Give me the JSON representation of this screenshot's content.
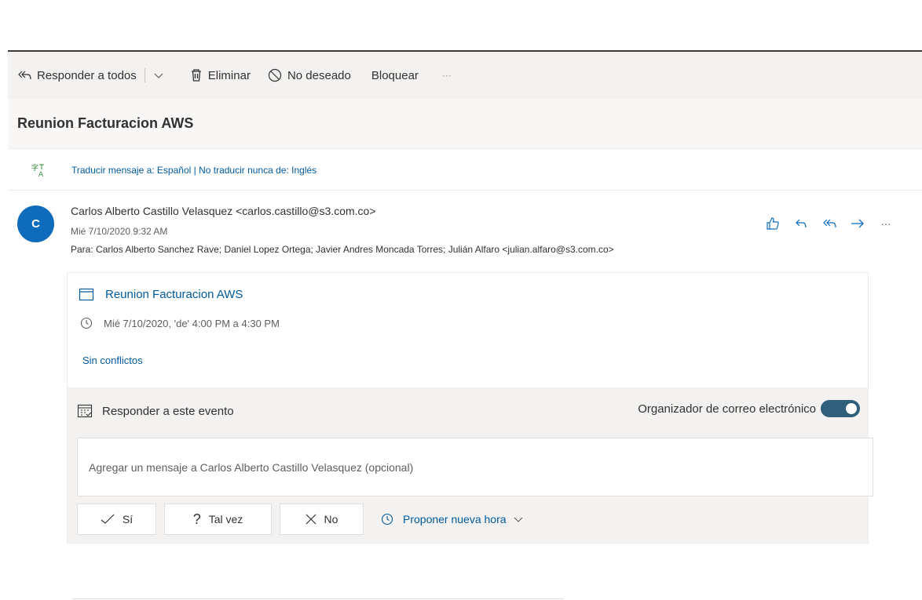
{
  "toolbar": {
    "reply_all": "Responder a todos",
    "delete": "Eliminar",
    "junk": "No deseado",
    "block": "Bloquear",
    "more": "···"
  },
  "message": {
    "subject": "Reunion Facturacion AWS",
    "translate_text": "Traducir mensaje a: Español | No traducir nunca de: Inglés",
    "avatar_initial": "C",
    "sender": "Carlos Alberto Castillo Velasquez <carlos.castillo@s3.com.co>",
    "date": "Mié 7/10/2020 9:32 AM",
    "to_label": "Para:",
    "to_recipients": "Carlos Alberto Sanchez Rave; Daniel Lopez Ortega; Javier Andres Moncada Torres; Julián Alfaro <julian.alfaro@s3.com.co>",
    "more_actions": "···"
  },
  "event": {
    "title": "Reunion Facturacion AWS",
    "time": "Mié 7/10/2020, 'de' 4:00 PM a 4:30 PM",
    "conflicts": "Sin conflictos",
    "respond_title": "Responder a este evento",
    "organizer_label": "Organizador de correo electrónico",
    "organizer_toggle_on": true,
    "message_placeholder": "Agregar un mensaje a Carlos Alberto Castillo Velasquez (opcional)",
    "yes": "Sí",
    "maybe": "Tal vez",
    "no": "No",
    "propose": "Proponer nueva hora"
  },
  "colors": {
    "accent_blue": "#005a9e",
    "avatar_bg": "#0f6cbd",
    "toggle_bg": "#2f5f7a"
  }
}
